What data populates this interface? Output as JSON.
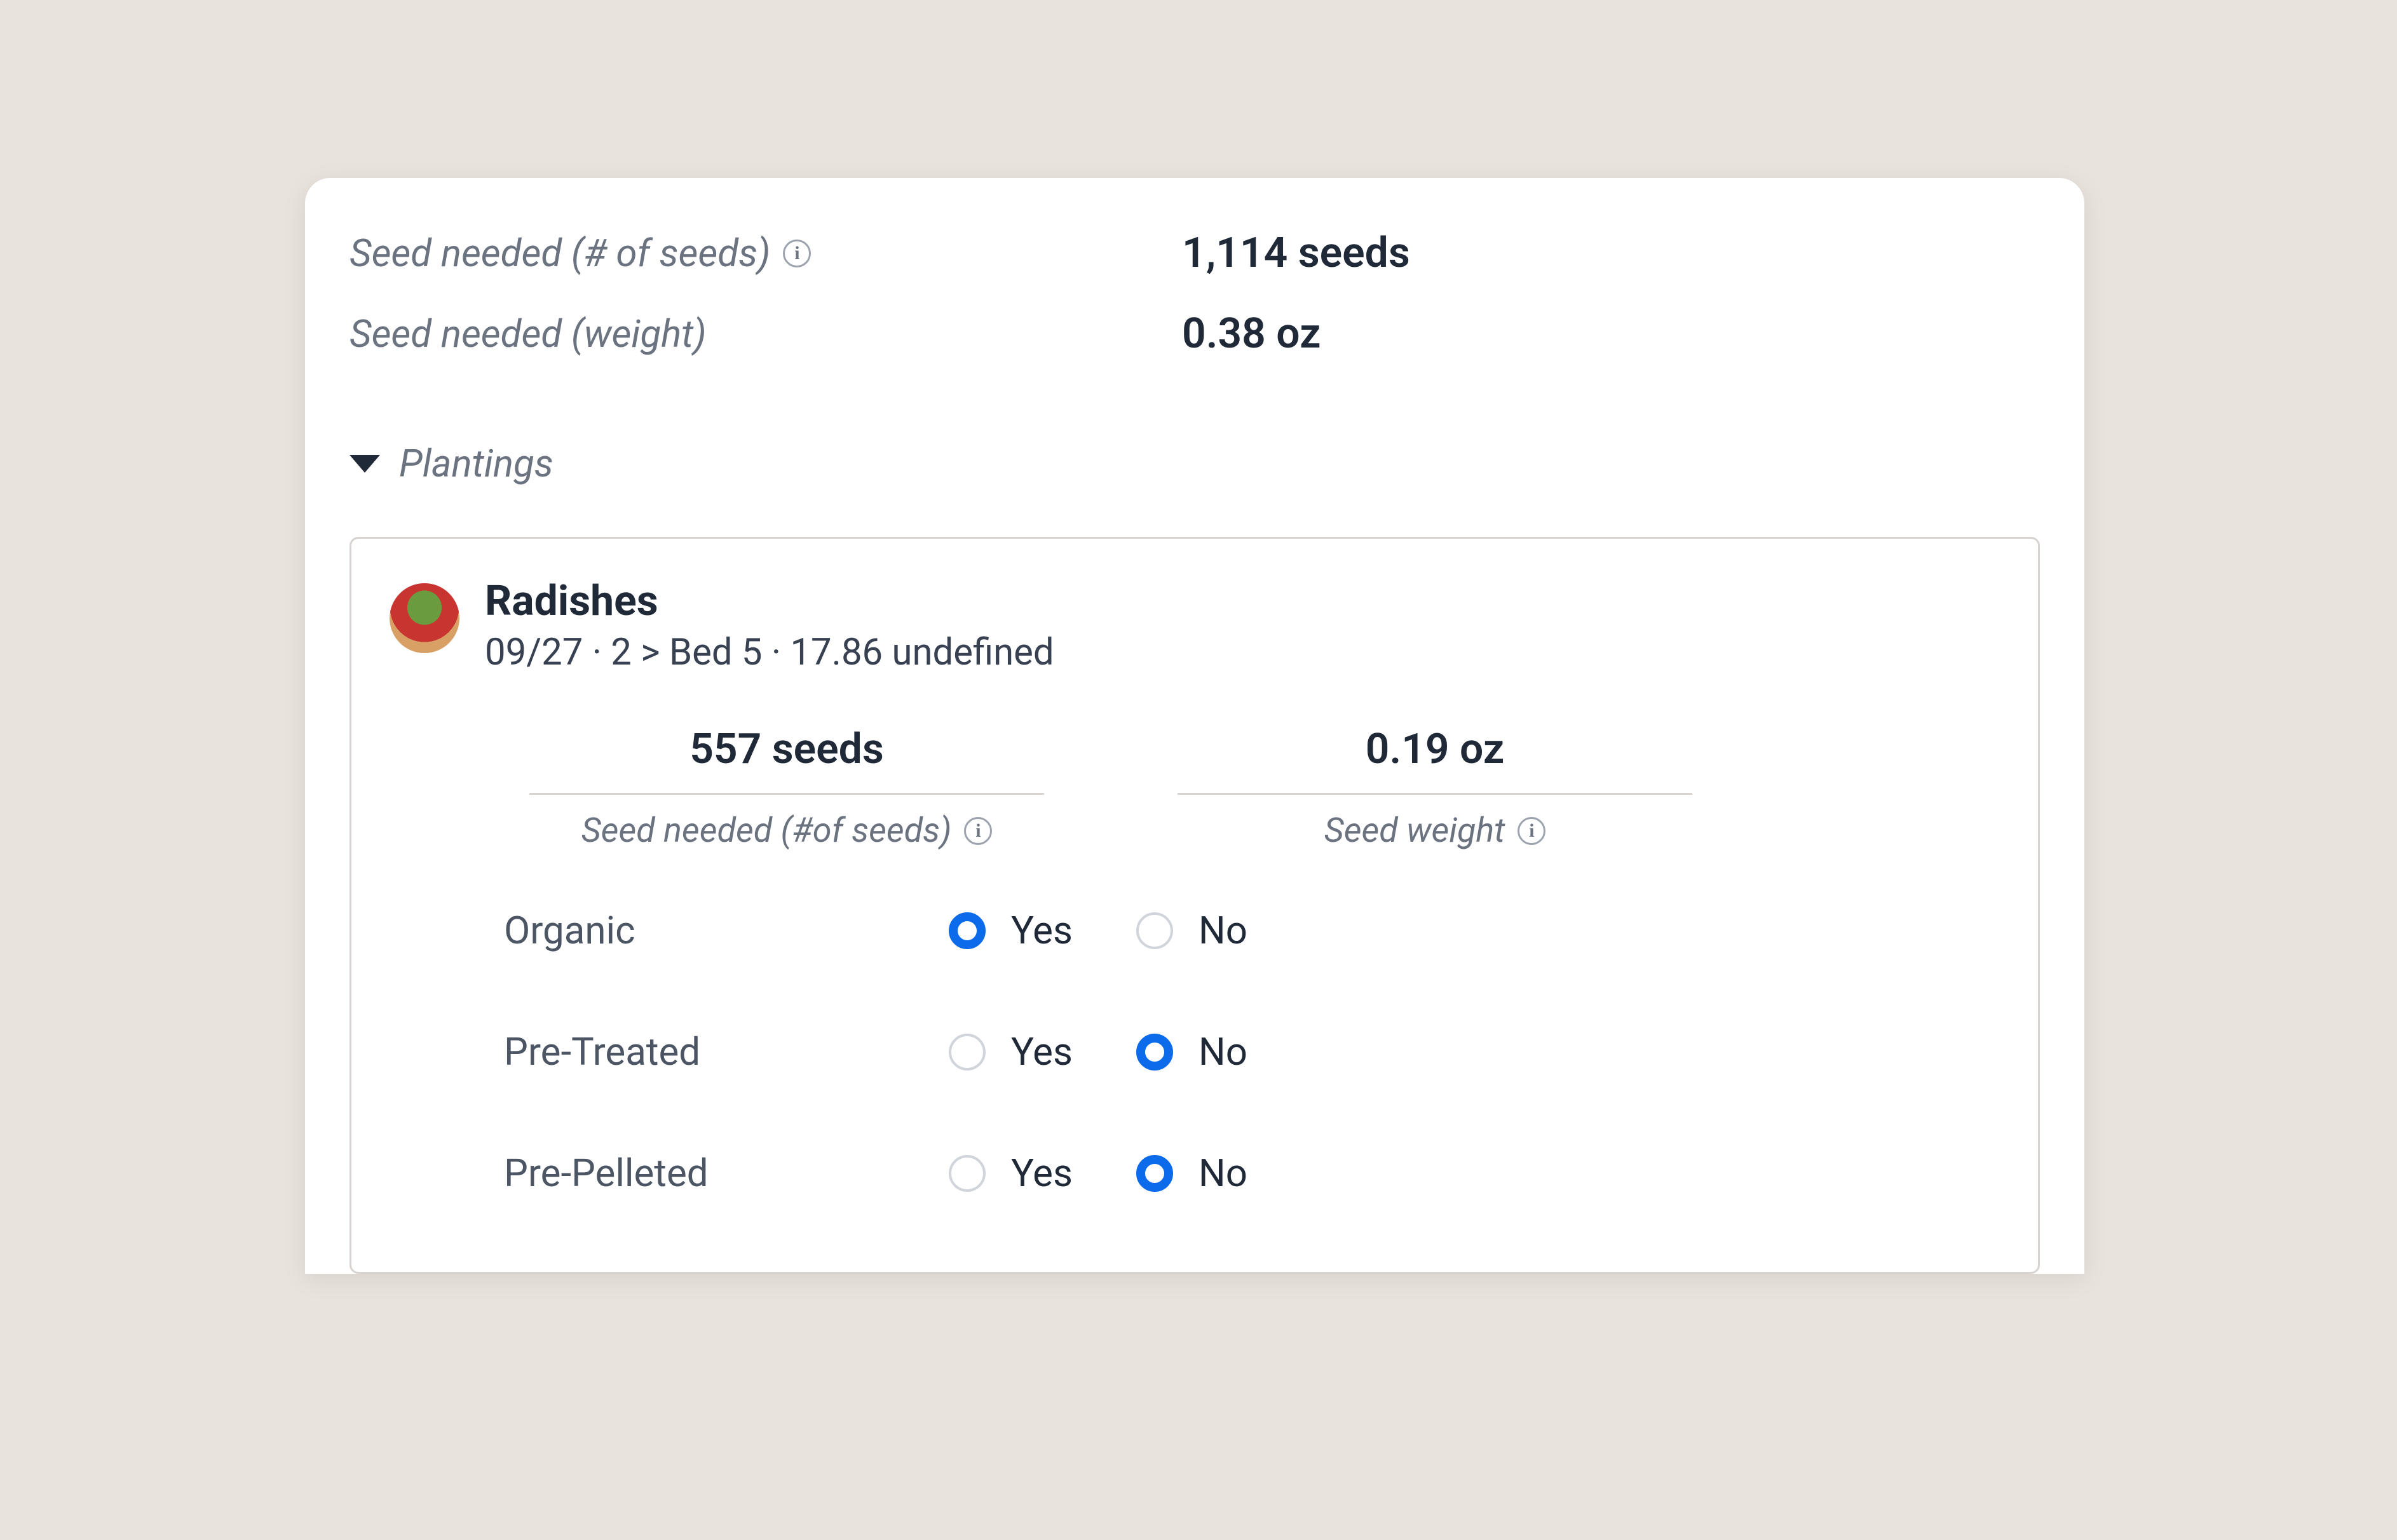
{
  "summary": {
    "seedsLabel": "Seed needed (# of seeds)",
    "seedsValue": "1,114 seeds",
    "weightLabel": "Seed needed (weight)",
    "weightValue": "0.38 oz"
  },
  "sectionTitle": "Plantings",
  "planting": {
    "name": "Radishes",
    "subline": "09/27 · 2 > Bed 5 · 17.86 undefined",
    "stats": {
      "seedsValue": "557 seeds",
      "seedsLabel": "Seed needed (#of seeds)",
      "weightValue": "0.19 oz",
      "weightLabel": "Seed weight"
    },
    "options": [
      {
        "label": "Organic",
        "yes": "Yes",
        "no": "No",
        "selected": "yes"
      },
      {
        "label": "Pre-Treated",
        "yes": "Yes",
        "no": "No",
        "selected": "no"
      },
      {
        "label": "Pre-Pelleted",
        "yes": "Yes",
        "no": "No",
        "selected": "no"
      }
    ]
  },
  "infoGlyph": "i"
}
